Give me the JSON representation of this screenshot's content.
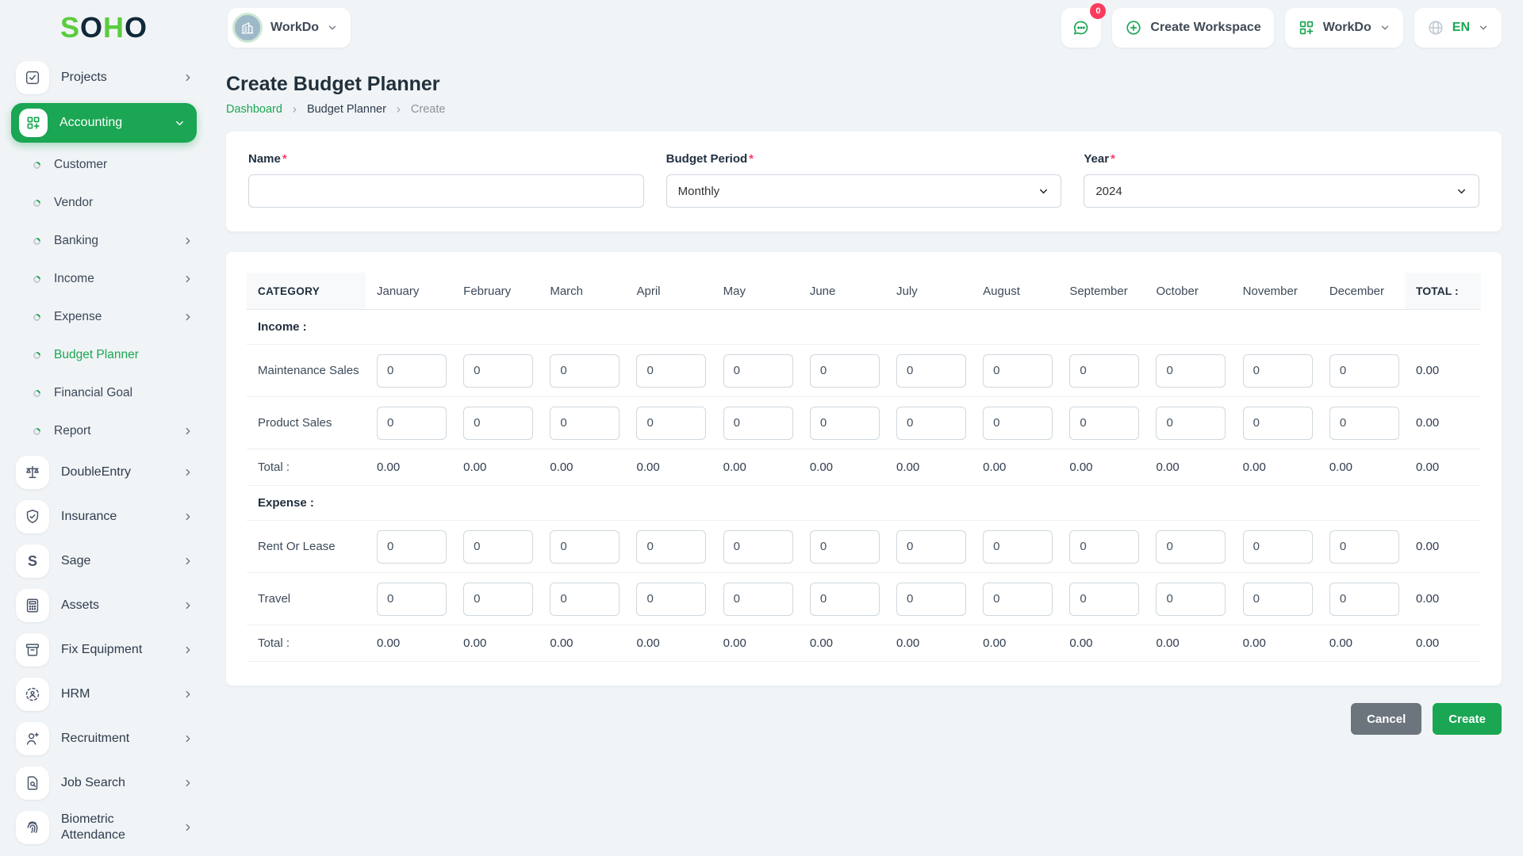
{
  "colors": {
    "accent": "#1aa653",
    "logo_green": "#5bcc3e",
    "navy": "#10293a",
    "badge_red": "#fb3b5c",
    "required_red": "#fb3b6b"
  },
  "brand": {
    "letters": [
      {
        "ch": "S",
        "tone": "green"
      },
      {
        "ch": "O",
        "tone": "navy"
      },
      {
        "ch": "H",
        "tone": "green"
      },
      {
        "ch": "O",
        "tone": "navy"
      }
    ]
  },
  "topbar": {
    "workspace": {
      "label": "WorkDo",
      "icon": "building-icon"
    },
    "messages_badge": "0",
    "create_workspace_label": "Create Workspace",
    "workdo_menu_label": "WorkDo",
    "language_code": "EN"
  },
  "sidebar": {
    "items": [
      {
        "label": "Projects",
        "type": "main",
        "icon": "checkbox-icon",
        "chevron": "right"
      },
      {
        "label": "Accounting",
        "type": "main",
        "icon": "modules-icon",
        "chevron": "down",
        "active": true
      },
      {
        "label": "Customer",
        "type": "sub"
      },
      {
        "label": "Vendor",
        "type": "sub"
      },
      {
        "label": "Banking",
        "type": "sub",
        "chevron": "right"
      },
      {
        "label": "Income",
        "type": "sub",
        "chevron": "right"
      },
      {
        "label": "Expense",
        "type": "sub",
        "chevron": "right"
      },
      {
        "label": "Budget Planner",
        "type": "sub",
        "active": true
      },
      {
        "label": "Financial Goal",
        "type": "sub"
      },
      {
        "label": "Report",
        "type": "sub",
        "chevron": "right"
      },
      {
        "label": "DoubleEntry",
        "type": "main",
        "icon": "scale-icon",
        "chevron": "right"
      },
      {
        "label": "Insurance",
        "type": "main",
        "icon": "shield-check-icon",
        "chevron": "right"
      },
      {
        "label": "Sage",
        "type": "main",
        "icon": "letter-s-icon",
        "chevron": "right"
      },
      {
        "label": "Assets",
        "type": "main",
        "icon": "calculator-icon",
        "chevron": "right"
      },
      {
        "label": "Fix Equipment",
        "type": "main",
        "icon": "archive-icon",
        "chevron": "right"
      },
      {
        "label": "HRM",
        "type": "main",
        "icon": "hrm-icon",
        "chevron": "right"
      },
      {
        "label": "Recruitment",
        "type": "main",
        "icon": "user-plus-icon",
        "chevron": "right"
      },
      {
        "label": "Job Search",
        "type": "main",
        "icon": "document-search-icon",
        "chevron": "right"
      },
      {
        "label": "Biometric Attendance",
        "type": "main",
        "icon": "fingerprint-icon",
        "chevron": "right"
      }
    ]
  },
  "page": {
    "title": "Create Budget Planner",
    "breadcrumb": [
      {
        "label": "Dashboard",
        "kind": "link"
      },
      {
        "label": "Budget Planner",
        "kind": "mid"
      },
      {
        "label": "Create",
        "kind": "muted"
      }
    ]
  },
  "form": {
    "name": {
      "label": "Name",
      "required": "*",
      "value": ""
    },
    "budget_period": {
      "label": "Budget Period",
      "required": "*",
      "value": "Monthly"
    },
    "year": {
      "label": "Year",
      "required": "*",
      "value": "2024"
    }
  },
  "table": {
    "category_header": "CATEGORY",
    "total_header": "TOTAL :",
    "months": [
      "January",
      "February",
      "March",
      "April",
      "May",
      "June",
      "July",
      "August",
      "September",
      "October",
      "November",
      "December"
    ],
    "sections": [
      {
        "title": "Income :",
        "rows": [
          {
            "label": "Maintenance Sales",
            "values": [
              "0",
              "0",
              "0",
              "0",
              "0",
              "0",
              "0",
              "0",
              "0",
              "0",
              "0",
              "0"
            ],
            "total": "0.00"
          },
          {
            "label": "Product Sales",
            "values": [
              "0",
              "0",
              "0",
              "0",
              "0",
              "0",
              "0",
              "0",
              "0",
              "0",
              "0",
              "0"
            ],
            "total": "0.00"
          }
        ],
        "total_row": {
          "label": "Total :",
          "values": [
            "0.00",
            "0.00",
            "0.00",
            "0.00",
            "0.00",
            "0.00",
            "0.00",
            "0.00",
            "0.00",
            "0.00",
            "0.00",
            "0.00"
          ],
          "total": "0.00"
        }
      },
      {
        "title": "Expense :",
        "rows": [
          {
            "label": "Rent Or Lease",
            "values": [
              "0",
              "0",
              "0",
              "0",
              "0",
              "0",
              "0",
              "0",
              "0",
              "0",
              "0",
              "0"
            ],
            "total": "0.00"
          },
          {
            "label": "Travel",
            "values": [
              "0",
              "0",
              "0",
              "0",
              "0",
              "0",
              "0",
              "0",
              "0",
              "0",
              "0",
              "0"
            ],
            "total": "0.00"
          }
        ],
        "total_row": {
          "label": "Total :",
          "values": [
            "0.00",
            "0.00",
            "0.00",
            "0.00",
            "0.00",
            "0.00",
            "0.00",
            "0.00",
            "0.00",
            "0.00",
            "0.00",
            "0.00"
          ],
          "total": "0.00"
        }
      }
    ]
  },
  "actions": {
    "cancel_label": "Cancel",
    "create_label": "Create"
  }
}
